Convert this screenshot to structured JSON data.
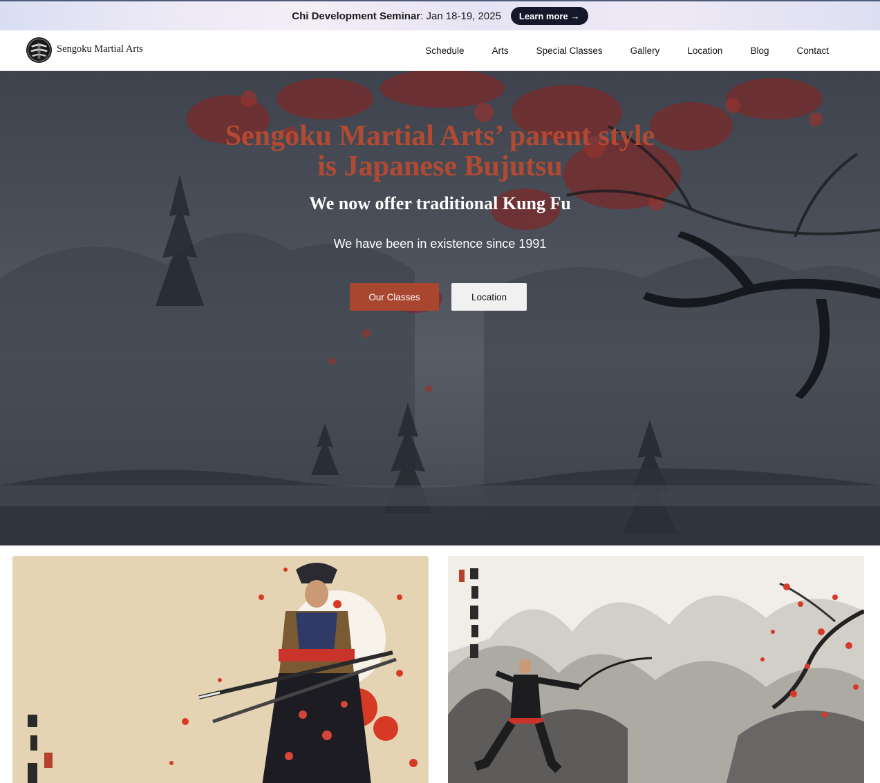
{
  "announcement": {
    "event_name": "Chi Development Seminar",
    "event_date": ": Jan 18-19, 2025",
    "cta_label": "Learn more",
    "cta_arrow": "→"
  },
  "header": {
    "brand": "Sengoku Martial Arts",
    "logo_icon": "dojo-emblem-icon",
    "nav": [
      "Schedule",
      "Arts",
      "Special Classes",
      "Gallery",
      "Location",
      "Blog",
      "Contact"
    ]
  },
  "hero": {
    "title_line1": "Sengoku Martial Arts’ parent style",
    "title_line2": "is Japanese Bujutsu",
    "subtitle": "We now offer traditional Kung Fu",
    "note": "We have been in existence since 1991",
    "primary_button": "Our Classes",
    "secondary_button": "Location"
  },
  "cards": [
    {
      "image": "samurai-ink-painting"
    },
    {
      "image": "kung-fu-mountain-ink-painting"
    }
  ],
  "colors": {
    "accent": "#a8462f",
    "title": "#b24a33",
    "announce_button": "#16182a"
  }
}
